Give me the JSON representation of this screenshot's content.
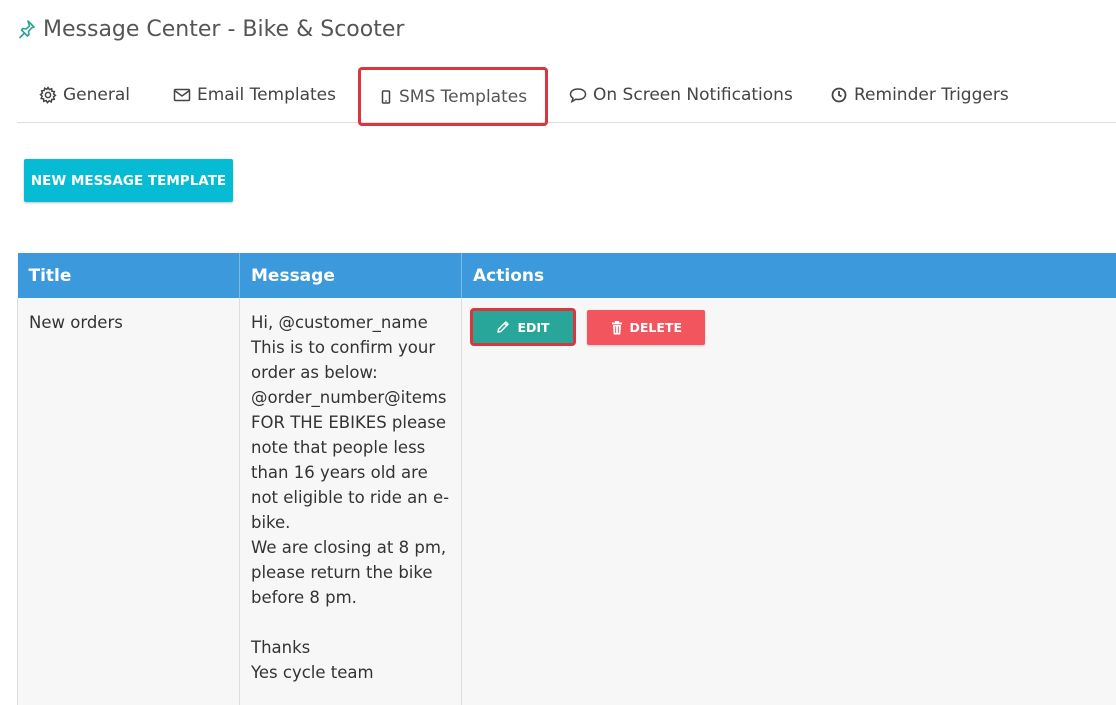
{
  "header": {
    "title": "Message Center - Bike & Scooter",
    "icon": "pin-icon"
  },
  "tabs": [
    {
      "label": "General",
      "icon": "gear-icon"
    },
    {
      "label": "Email Templates",
      "icon": "envelope-icon"
    },
    {
      "label": "SMS Templates",
      "icon": "mobile-phone-icon",
      "active": true
    },
    {
      "label": "On Screen Notifications",
      "icon": "speech-bubble-icon"
    },
    {
      "label": "Reminder Triggers",
      "icon": "clock-icon"
    }
  ],
  "toolbar": {
    "new_template_label": "NEW MESSAGE TEMPLATE"
  },
  "table": {
    "columns": [
      "Title",
      "Message",
      "Actions"
    ],
    "rows": [
      {
        "title": "New orders",
        "message": "Hi, @customer_name\nThis is to confirm your order as below: @order_number@items FOR THE EBIKES please note that people less than 16 years old are not eligible to ride an e-bike.\nWe are closing at 8 pm, please return the bike before 8 pm.\n\nThanks\nYes cycle team",
        "edit_label": "EDIT",
        "delete_label": "DELETE"
      }
    ]
  },
  "colors": {
    "accent": "#06bcd4",
    "table_header": "#3b99dc",
    "edit": "#27a699",
    "delete": "#f2555d",
    "highlight": "#d9363e"
  }
}
